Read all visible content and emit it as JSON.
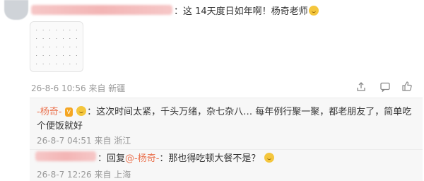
{
  "comment": {
    "text": "：这 14天度日如年啊！杨奇老师",
    "sticker_glyphs": [
      "·",
      "·",
      "·",
      "·",
      "·",
      "·",
      "·",
      "·",
      "·",
      "·",
      "·",
      "·",
      "·",
      "·",
      "·",
      "·",
      "·",
      "·",
      "·",
      "·",
      "·",
      "·",
      "·",
      "·",
      "·",
      "·",
      "·",
      "·",
      "·",
      "·",
      "·",
      "·",
      "·",
      "·",
      "·"
    ],
    "time": "26-8-6 10:56",
    "source": "来自 新疆"
  },
  "replies": [
    {
      "author": "-杨奇-",
      "text_line1": "：这次时间太紧，千头万绪，杂七杂八… 每年例行聚一聚，都老朋友了，简单吃",
      "text_line2": "个便饭就好",
      "time": "26-8-7 04:51",
      "source": "来自 浙江"
    },
    {
      "prefix": "：回复",
      "mention": "@-杨奇-",
      "text": "：那也得吃顿大餐不是？",
      "time": "26-8-7 12:26",
      "source": "来自 上海"
    }
  ],
  "colors": {
    "accent": "#eb7350",
    "meta": "#999999",
    "reply_bg": "#f7f7f7"
  },
  "icons": [
    "share-icon",
    "comment-icon",
    "like-icon"
  ]
}
